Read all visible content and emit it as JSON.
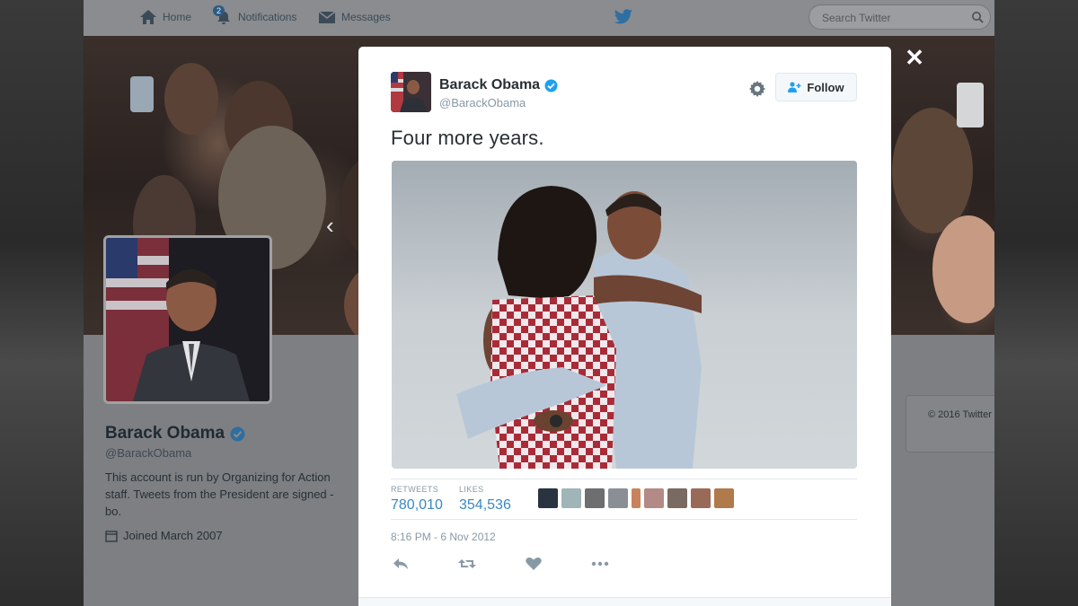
{
  "nav": {
    "home_label": "Home",
    "notifications_label": "Notifications",
    "notifications_count": "2",
    "messages_label": "Messages",
    "search_placeholder": "Search Twitter"
  },
  "profile": {
    "name": "Barack Obama",
    "handle": "@BarackObama",
    "bio": "This account is run by Organizing for Action staff. Tweets from the President are signed -bo.",
    "joined": "Joined March 2007"
  },
  "footer": {
    "copyright": "© 2016 Twitter"
  },
  "tweet": {
    "author_name": "Barack Obama",
    "author_handle": "@BarackObama",
    "verified": true,
    "follow_label": "Follow",
    "text": "Four more years.",
    "retweets_label": "RETWEETS",
    "retweets_value": "780,010",
    "likes_label": "LIKES",
    "likes_value": "354,536",
    "timestamp": "8:16 PM - 6 Nov 2012"
  },
  "colors": {
    "accent": "#3b88c3",
    "verified": "#1da1f2",
    "text_primary": "#292f33",
    "text_secondary": "#8899a6"
  },
  "icons": [
    "home-icon",
    "notifications-icon",
    "messages-icon",
    "twitter-bird-icon",
    "search-icon",
    "verified-icon",
    "gear-icon",
    "follow-user-icon",
    "reply-icon",
    "retweet-icon",
    "like-icon",
    "more-icon",
    "close-icon",
    "calendar-icon"
  ]
}
